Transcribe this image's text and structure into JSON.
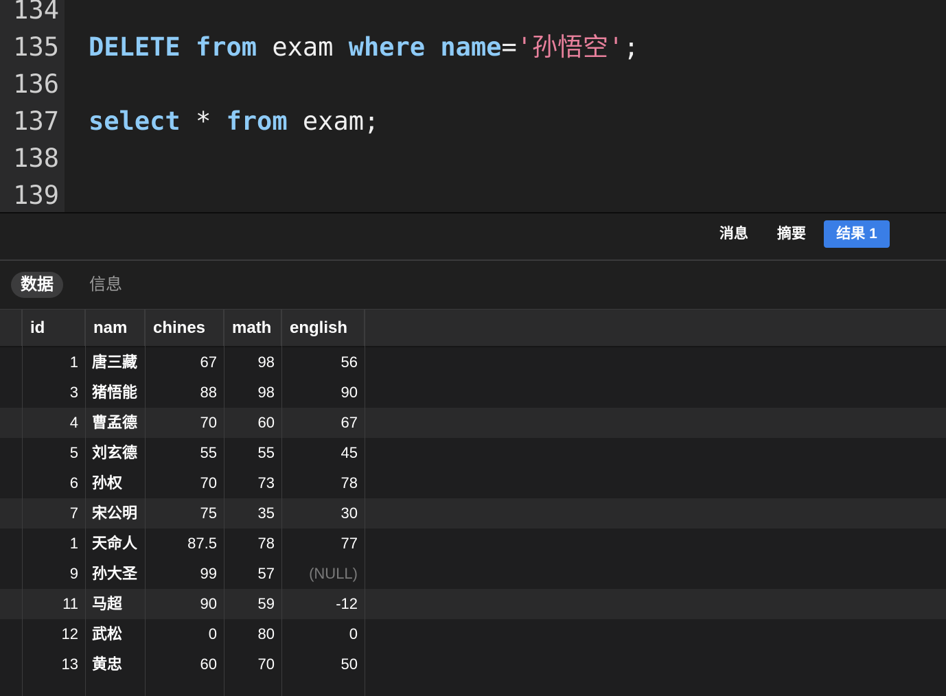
{
  "editor": {
    "lines": [
      {
        "num": "134",
        "code": ""
      },
      {
        "num": "135",
        "code": "DELETE from exam where name='孙悟空';"
      },
      {
        "num": "136",
        "code": ""
      },
      {
        "num": "137",
        "code": "select * from exam;"
      },
      {
        "num": "138",
        "code": ""
      },
      {
        "num": "139",
        "code": ""
      }
    ],
    "l135": {
      "delete": "DELETE",
      "from": "from",
      "table": "exam",
      "where": "where",
      "col": "name",
      "eq": "=",
      "str": "'孙悟空'",
      "semi": ";"
    },
    "l137": {
      "select": "select",
      "star": "*",
      "from": "from",
      "table": "exam",
      "semi": ";"
    },
    "colors": {
      "keyword": "#8ecbf7",
      "string": "#e8809c",
      "text": "#f0f0f0"
    }
  },
  "result_tabs": {
    "messages": "消息",
    "summary": "摘要",
    "result1": "结果 1",
    "active_color": "#3a7ee6"
  },
  "sub_tabs": {
    "data": "数据",
    "info": "信息"
  },
  "grid": {
    "columns": [
      "id",
      "nam",
      "chines",
      "math",
      "english"
    ],
    "rows": [
      {
        "id": "1",
        "nam": "唐三藏",
        "chines": "67",
        "math": "98",
        "english": "56"
      },
      {
        "id": "3",
        "nam": "猪悟能",
        "chines": "88",
        "math": "98",
        "english": "90"
      },
      {
        "id": "4",
        "nam": "曹孟德",
        "chines": "70",
        "math": "60",
        "english": "67"
      },
      {
        "id": "5",
        "nam": "刘玄德",
        "chines": "55",
        "math": "55",
        "english": "45"
      },
      {
        "id": "6",
        "nam": "孙权",
        "chines": "70",
        "math": "73",
        "english": "78"
      },
      {
        "id": "7",
        "nam": "宋公明",
        "chines": "75",
        "math": "35",
        "english": "30"
      },
      {
        "id": "1",
        "nam": "天命人",
        "chines": "87.5",
        "math": "78",
        "english": "77"
      },
      {
        "id": "9",
        "nam": "孙大圣",
        "chines": "99",
        "math": "57",
        "english": "(NULL)"
      },
      {
        "id": "11",
        "nam": "马超",
        "chines": "90",
        "math": "59",
        "english": "-12"
      },
      {
        "id": "12",
        "nam": "武松",
        "chines": "0",
        "math": "80",
        "english": "0"
      },
      {
        "id": "13",
        "nam": "黄忠",
        "chines": "60",
        "math": "70",
        "english": "50"
      }
    ]
  }
}
